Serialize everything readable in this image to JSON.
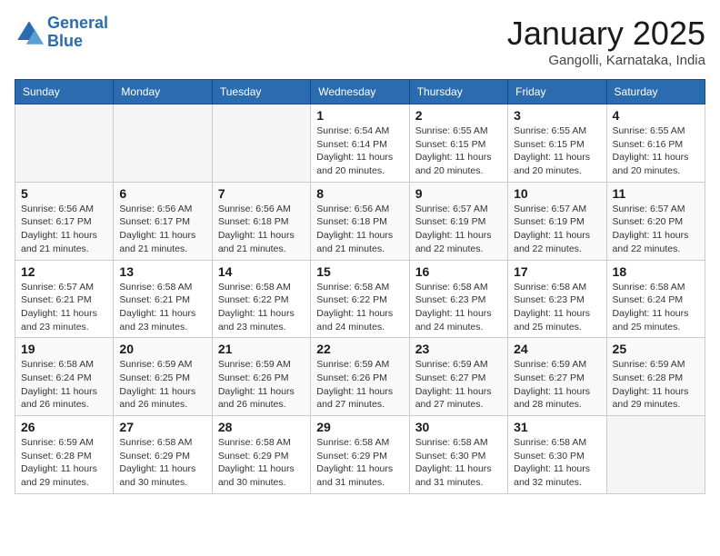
{
  "logo": {
    "line1": "General",
    "line2": "Blue"
  },
  "title": "January 2025",
  "location": "Gangolli, Karnataka, India",
  "days_header": [
    "Sunday",
    "Monday",
    "Tuesday",
    "Wednesday",
    "Thursday",
    "Friday",
    "Saturday"
  ],
  "weeks": [
    [
      {
        "day": "",
        "info": "",
        "empty": true
      },
      {
        "day": "",
        "info": "",
        "empty": true
      },
      {
        "day": "",
        "info": "",
        "empty": true
      },
      {
        "day": "1",
        "info": "Sunrise: 6:54 AM\nSunset: 6:14 PM\nDaylight: 11 hours and 20 minutes.",
        "empty": false
      },
      {
        "day": "2",
        "info": "Sunrise: 6:55 AM\nSunset: 6:15 PM\nDaylight: 11 hours and 20 minutes.",
        "empty": false
      },
      {
        "day": "3",
        "info": "Sunrise: 6:55 AM\nSunset: 6:15 PM\nDaylight: 11 hours and 20 minutes.",
        "empty": false
      },
      {
        "day": "4",
        "info": "Sunrise: 6:55 AM\nSunset: 6:16 PM\nDaylight: 11 hours and 20 minutes.",
        "empty": false
      }
    ],
    [
      {
        "day": "5",
        "info": "Sunrise: 6:56 AM\nSunset: 6:17 PM\nDaylight: 11 hours and 21 minutes.",
        "empty": false
      },
      {
        "day": "6",
        "info": "Sunrise: 6:56 AM\nSunset: 6:17 PM\nDaylight: 11 hours and 21 minutes.",
        "empty": false
      },
      {
        "day": "7",
        "info": "Sunrise: 6:56 AM\nSunset: 6:18 PM\nDaylight: 11 hours and 21 minutes.",
        "empty": false
      },
      {
        "day": "8",
        "info": "Sunrise: 6:56 AM\nSunset: 6:18 PM\nDaylight: 11 hours and 21 minutes.",
        "empty": false
      },
      {
        "day": "9",
        "info": "Sunrise: 6:57 AM\nSunset: 6:19 PM\nDaylight: 11 hours and 22 minutes.",
        "empty": false
      },
      {
        "day": "10",
        "info": "Sunrise: 6:57 AM\nSunset: 6:19 PM\nDaylight: 11 hours and 22 minutes.",
        "empty": false
      },
      {
        "day": "11",
        "info": "Sunrise: 6:57 AM\nSunset: 6:20 PM\nDaylight: 11 hours and 22 minutes.",
        "empty": false
      }
    ],
    [
      {
        "day": "12",
        "info": "Sunrise: 6:57 AM\nSunset: 6:21 PM\nDaylight: 11 hours and 23 minutes.",
        "empty": false
      },
      {
        "day": "13",
        "info": "Sunrise: 6:58 AM\nSunset: 6:21 PM\nDaylight: 11 hours and 23 minutes.",
        "empty": false
      },
      {
        "day": "14",
        "info": "Sunrise: 6:58 AM\nSunset: 6:22 PM\nDaylight: 11 hours and 23 minutes.",
        "empty": false
      },
      {
        "day": "15",
        "info": "Sunrise: 6:58 AM\nSunset: 6:22 PM\nDaylight: 11 hours and 24 minutes.",
        "empty": false
      },
      {
        "day": "16",
        "info": "Sunrise: 6:58 AM\nSunset: 6:23 PM\nDaylight: 11 hours and 24 minutes.",
        "empty": false
      },
      {
        "day": "17",
        "info": "Sunrise: 6:58 AM\nSunset: 6:23 PM\nDaylight: 11 hours and 25 minutes.",
        "empty": false
      },
      {
        "day": "18",
        "info": "Sunrise: 6:58 AM\nSunset: 6:24 PM\nDaylight: 11 hours and 25 minutes.",
        "empty": false
      }
    ],
    [
      {
        "day": "19",
        "info": "Sunrise: 6:58 AM\nSunset: 6:24 PM\nDaylight: 11 hours and 26 minutes.",
        "empty": false
      },
      {
        "day": "20",
        "info": "Sunrise: 6:59 AM\nSunset: 6:25 PM\nDaylight: 11 hours and 26 minutes.",
        "empty": false
      },
      {
        "day": "21",
        "info": "Sunrise: 6:59 AM\nSunset: 6:26 PM\nDaylight: 11 hours and 26 minutes.",
        "empty": false
      },
      {
        "day": "22",
        "info": "Sunrise: 6:59 AM\nSunset: 6:26 PM\nDaylight: 11 hours and 27 minutes.",
        "empty": false
      },
      {
        "day": "23",
        "info": "Sunrise: 6:59 AM\nSunset: 6:27 PM\nDaylight: 11 hours and 27 minutes.",
        "empty": false
      },
      {
        "day": "24",
        "info": "Sunrise: 6:59 AM\nSunset: 6:27 PM\nDaylight: 11 hours and 28 minutes.",
        "empty": false
      },
      {
        "day": "25",
        "info": "Sunrise: 6:59 AM\nSunset: 6:28 PM\nDaylight: 11 hours and 29 minutes.",
        "empty": false
      }
    ],
    [
      {
        "day": "26",
        "info": "Sunrise: 6:59 AM\nSunset: 6:28 PM\nDaylight: 11 hours and 29 minutes.",
        "empty": false
      },
      {
        "day": "27",
        "info": "Sunrise: 6:58 AM\nSunset: 6:29 PM\nDaylight: 11 hours and 30 minutes.",
        "empty": false
      },
      {
        "day": "28",
        "info": "Sunrise: 6:58 AM\nSunset: 6:29 PM\nDaylight: 11 hours and 30 minutes.",
        "empty": false
      },
      {
        "day": "29",
        "info": "Sunrise: 6:58 AM\nSunset: 6:29 PM\nDaylight: 11 hours and 31 minutes.",
        "empty": false
      },
      {
        "day": "30",
        "info": "Sunrise: 6:58 AM\nSunset: 6:30 PM\nDaylight: 11 hours and 31 minutes.",
        "empty": false
      },
      {
        "day": "31",
        "info": "Sunrise: 6:58 AM\nSunset: 6:30 PM\nDaylight: 11 hours and 32 minutes.",
        "empty": false
      },
      {
        "day": "",
        "info": "",
        "empty": true
      }
    ]
  ]
}
